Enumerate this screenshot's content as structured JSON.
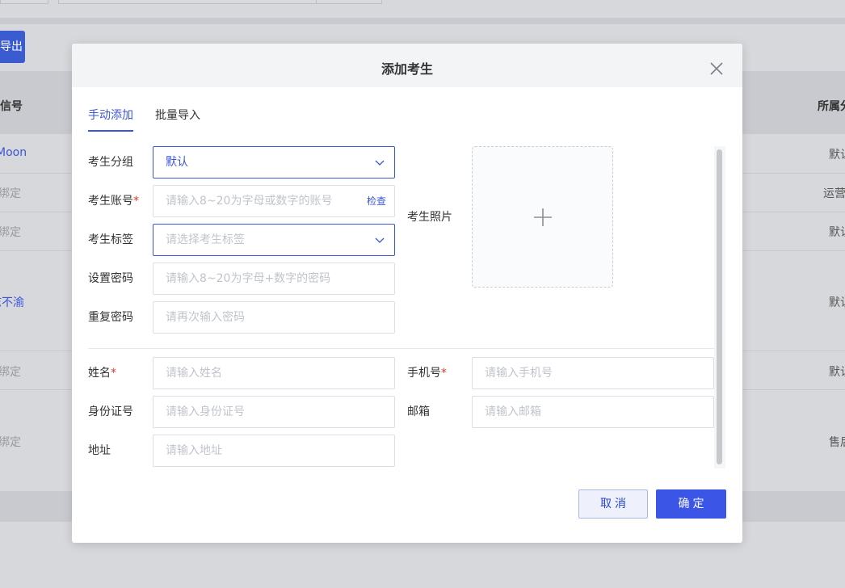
{
  "background": {
    "export_label": "导出",
    "header_cells": [
      "微信号",
      "所属分"
    ],
    "rows": [
      {
        "left": "Moon",
        "right": "默认",
        "left_link": true
      },
      {
        "left": "未绑定",
        "right": "运营"
      },
      {
        "left": "未绑定",
        "right": "默认"
      },
      {
        "left": "志不渝",
        "right": "默认",
        "left_link": true
      },
      {
        "left": "未绑定",
        "right": "默认"
      },
      {
        "left": "未绑定",
        "right": "售后"
      }
    ]
  },
  "modal": {
    "title": "添加考生",
    "tabs": [
      {
        "label": "手动添加",
        "active": true
      },
      {
        "label": "批量导入",
        "active": false
      }
    ],
    "form": {
      "group": {
        "label": "考生分组",
        "value": "默认"
      },
      "account": {
        "label": "考生账号",
        "required_mark": "*",
        "placeholder": "请输入8~20为字母或数字的账号",
        "check_label": "检查"
      },
      "tags": {
        "label": "考生标签",
        "placeholder": "请选择考生标签"
      },
      "password": {
        "label": "设置密码",
        "placeholder": "请输入8~20为字母+数字的密码"
      },
      "repeat_password": {
        "label": "重复密码",
        "placeholder": "请再次输入密码"
      },
      "photo": {
        "label": "考生照片"
      },
      "name": {
        "label": "姓名",
        "required_mark": "*",
        "placeholder": "请输入姓名"
      },
      "phone": {
        "label": "手机号",
        "required_mark": "*",
        "placeholder": "请输入手机号"
      },
      "id_card": {
        "label": "身份证号",
        "placeholder": "请输入身份证号"
      },
      "email": {
        "label": "邮箱",
        "placeholder": "请输入邮箱"
      },
      "address": {
        "label": "地址",
        "placeholder": "请输入地址"
      }
    },
    "buttons": {
      "cancel": "取消",
      "confirm": "确定"
    }
  },
  "colors": {
    "accent": "#3b55d9",
    "required": "#e0352b",
    "primary_button": "#3b55e6"
  }
}
